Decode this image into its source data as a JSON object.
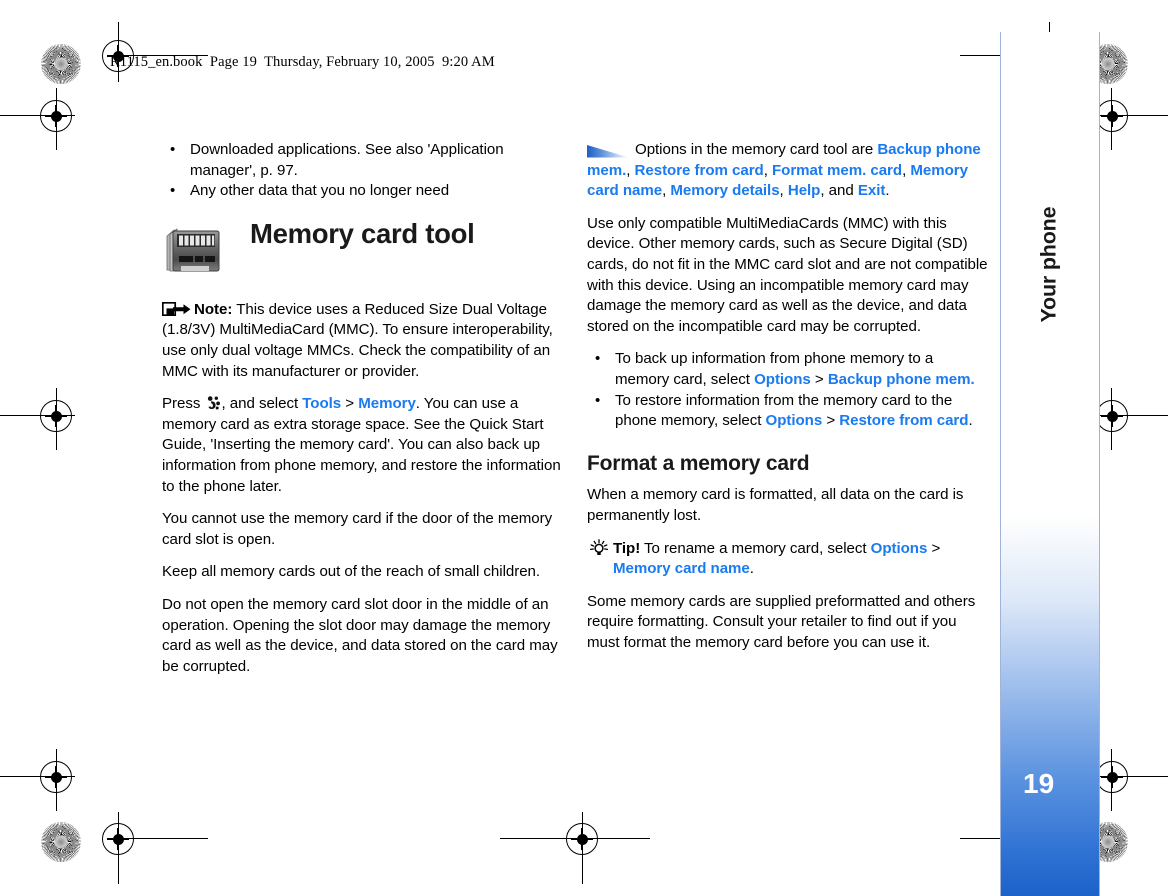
{
  "document": {
    "header_line": "R1115_en.book  Page 19  Thursday, February 10, 2005  9:20 AM",
    "page_number": "19",
    "section_title": "Your phone",
    "accent_color": "#1a7af0",
    "sidebar_color": "#2f72d4"
  },
  "left_column": {
    "intro_bullets": [
      "Downloaded applications. See also 'Application manager', p. 97.",
      "Any other data that you no longer need"
    ],
    "heading": "Memory card tool",
    "heading_icon": "memory-card-icon",
    "note": {
      "icon": "note-arrow-icon",
      "label": "Note:",
      "text": " This device uses a Reduced Size Dual Voltage (1.8/3V) MultiMediaCard (MMC). To ensure interoperability, use only dual voltage MMCs. Check the compatibility of an MMC with its manufacturer or provider."
    },
    "press_paragraph": {
      "prefix": "Press",
      "key_icon": "menu-key-icon",
      "middle": ", and select ",
      "ui_1": "Tools",
      "separator": ">",
      "ui_2": "Memory",
      "suffix": ". You can use a memory card as extra storage space. See the Quick Start Guide, 'Inserting the memory card'. You can also back up information from phone memory, and restore the information to the phone later."
    },
    "paragraphs": [
      "You cannot use the memory card if the door of the memory card slot is open.",
      "Keep all memory cards out of the reach of small children.",
      "Do not open the memory card slot door in the middle of an operation. Opening the slot door may damage the memory card as well as the device, and data stored on the card may be corrupted."
    ]
  },
  "right_column": {
    "options_callout": {
      "icon": "triangle-pointer-icon",
      "prefix": "Options in the memory card tool are ",
      "items": [
        "Backup phone mem.",
        "Restore from card",
        "Format mem. card",
        "Memory card name",
        "Memory details",
        "Help",
        "Exit"
      ],
      "conjunction": "and",
      "suffix": "."
    },
    "compat_paragraph": "Use only compatible MultiMediaCards (MMC) with this device. Other memory cards, such as Secure Digital (SD) cards, do not fit in the MMC card slot and are not compatible with this device. Using an incompatible memory card may damage the memory card as well as the device, and data stored on the incompatible card may be corrupted.",
    "action_bullets": [
      {
        "prefix": "To back up information from phone memory to a memory card, select ",
        "ui_1": "Options",
        "separator": ">",
        "ui_2": "Backup phone mem.",
        "suffix": ""
      },
      {
        "prefix": "To restore information from the memory card to the phone memory, select ",
        "ui_1": "Options",
        "separator": ">",
        "ui_2": "Restore from card",
        "suffix": "."
      }
    ],
    "format_heading": "Format a memory card",
    "format_warning": "When a memory card is formatted, all data on the card is permanently lost.",
    "tip": {
      "icon": "lightbulb-icon",
      "label": "Tip!",
      "prefix": " To rename a memory card, select ",
      "ui_1": "Options",
      "separator": ">",
      "ui_2": "Memory card name",
      "suffix": "."
    },
    "closing_paragraph": "Some memory cards are supplied preformatted and others require formatting. Consult your retailer to find out if you must format the memory card before you can use it."
  }
}
